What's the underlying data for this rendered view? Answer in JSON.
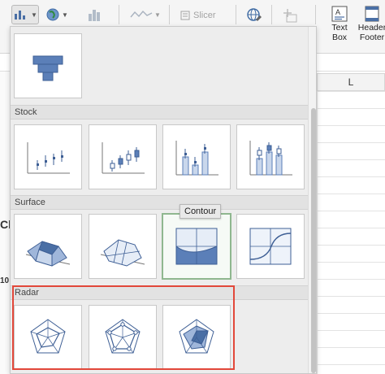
{
  "ribbon": {
    "slicer_label": "Slicer",
    "text_box_label_1": "Text",
    "text_box_label_2": "Box",
    "header_footer_label_1": "Header",
    "header_footer_label_2": "Footer"
  },
  "sheet": {
    "column_l": "L",
    "left_fragment_1": "Ch",
    "left_fragment_2": "10"
  },
  "gallery": {
    "sections": {
      "stock": "Stock",
      "surface": "Surface",
      "radar": "Radar"
    },
    "tooltip": "Contour",
    "accent_color": "#4a6fa5",
    "highlight_color": "#e2483a"
  }
}
